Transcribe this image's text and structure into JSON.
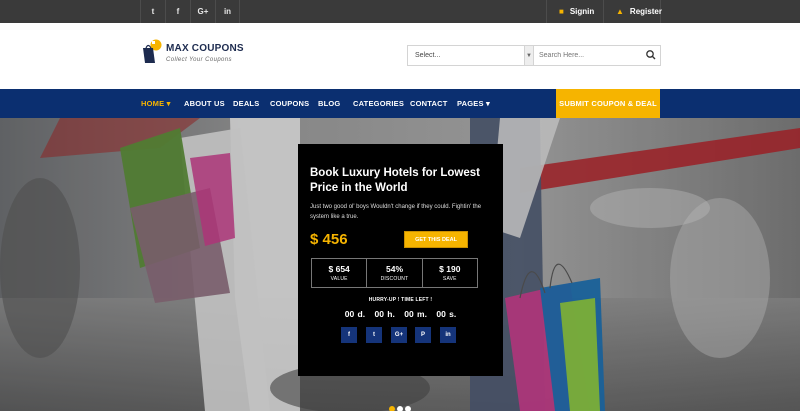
{
  "topbar": {
    "social": [
      {
        "glyph": "t",
        "icon": "twitter-icon"
      },
      {
        "glyph": "f",
        "icon": "facebook-icon"
      },
      {
        "glyph": "G+",
        "icon": "google-plus-icon"
      },
      {
        "glyph": "in",
        "icon": "linkedin-icon"
      }
    ],
    "signin_label": "Signin",
    "register_label": "Register"
  },
  "brand": {
    "name": "MAX COUPONS",
    "tagline": "Collect Your Coupons"
  },
  "search": {
    "select_value": "Select...",
    "placeholder": "Search Here..."
  },
  "nav": {
    "items": [
      {
        "label": "HOME ▾"
      },
      {
        "label": "ABOUT US"
      },
      {
        "label": "DEALS"
      },
      {
        "label": "COUPONS"
      },
      {
        "label": "BLOG"
      },
      {
        "label": "CATEGORIES"
      },
      {
        "label": "CONTACT"
      },
      {
        "label": "PAGES ▾"
      }
    ],
    "submit_label": "SUBMIT COUPON & DEAL"
  },
  "deal": {
    "title": "Book Luxury Hotels for Lowest Price in the World",
    "description": "Just two good ol' boys Wouldn't change if they could. Fightin' the system like a true.",
    "price": "$ 456",
    "cta_label": "GET THIS DEAL",
    "stats": [
      {
        "value": "$ 654",
        "label": "VALUE"
      },
      {
        "value": "54%",
        "label": "DISCOUNT"
      },
      {
        "value": "$ 190",
        "label": "SAVE"
      }
    ],
    "hurry_label": "HURRY-UP ! TIME LEFT !",
    "timer": {
      "days": "00 d.",
      "hours": "00 h.",
      "minutes": "00 m.",
      "seconds": "00 s."
    },
    "share": [
      {
        "glyph": "f",
        "icon": "facebook-icon"
      },
      {
        "glyph": "t",
        "icon": "twitter-icon"
      },
      {
        "glyph": "G+",
        "icon": "google-plus-icon"
      },
      {
        "glyph": "P",
        "icon": "pinterest-icon"
      },
      {
        "glyph": "in",
        "icon": "linkedin-icon"
      }
    ]
  },
  "colors": {
    "accent": "#f6b400",
    "nav_bg": "#0b2f70",
    "topbar_bg": "#3a3a3a"
  }
}
